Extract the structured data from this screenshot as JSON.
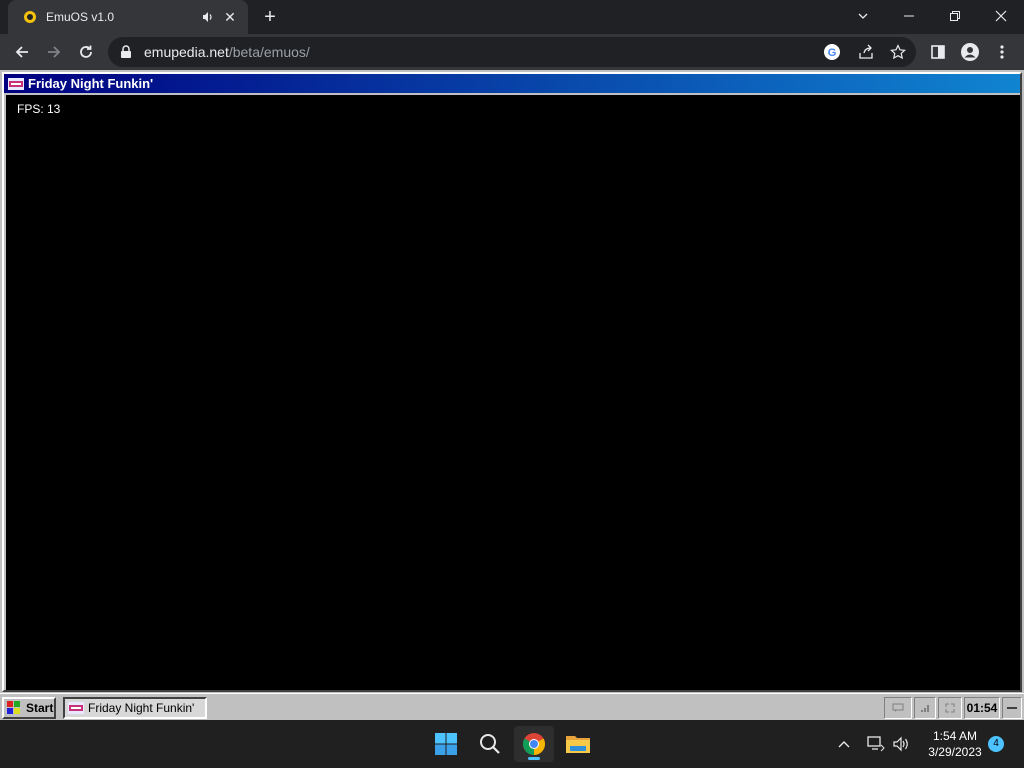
{
  "browser": {
    "tab": {
      "title": "EmuOS v1.0",
      "favicon": "emuos-icon",
      "audio_icon": "speaker-icon"
    },
    "new_tab_label": "+",
    "url": {
      "domain": "emupedia.net",
      "path": "/beta/emuos/"
    },
    "colors": {
      "tabstrip": "#202124",
      "toolbar": "#35363a",
      "omnibox": "#202124"
    }
  },
  "emuos": {
    "window": {
      "title": "Friday Night Funkin'",
      "fps_label": "FPS: 13"
    },
    "taskbar": {
      "start_label": "Start",
      "task_label": "Friday Night Funkin'",
      "clock": "01:54"
    },
    "colors": {
      "titlebar_start": "#000080",
      "titlebar_end": "#1084d0",
      "face": "#c0c0c0"
    }
  },
  "windows_taskbar": {
    "time": "1:54 AM",
    "date": "3/29/2023",
    "notification_count": "4",
    "apps": [
      "start-icon",
      "search-icon",
      "chrome-icon",
      "file-explorer-icon"
    ]
  }
}
